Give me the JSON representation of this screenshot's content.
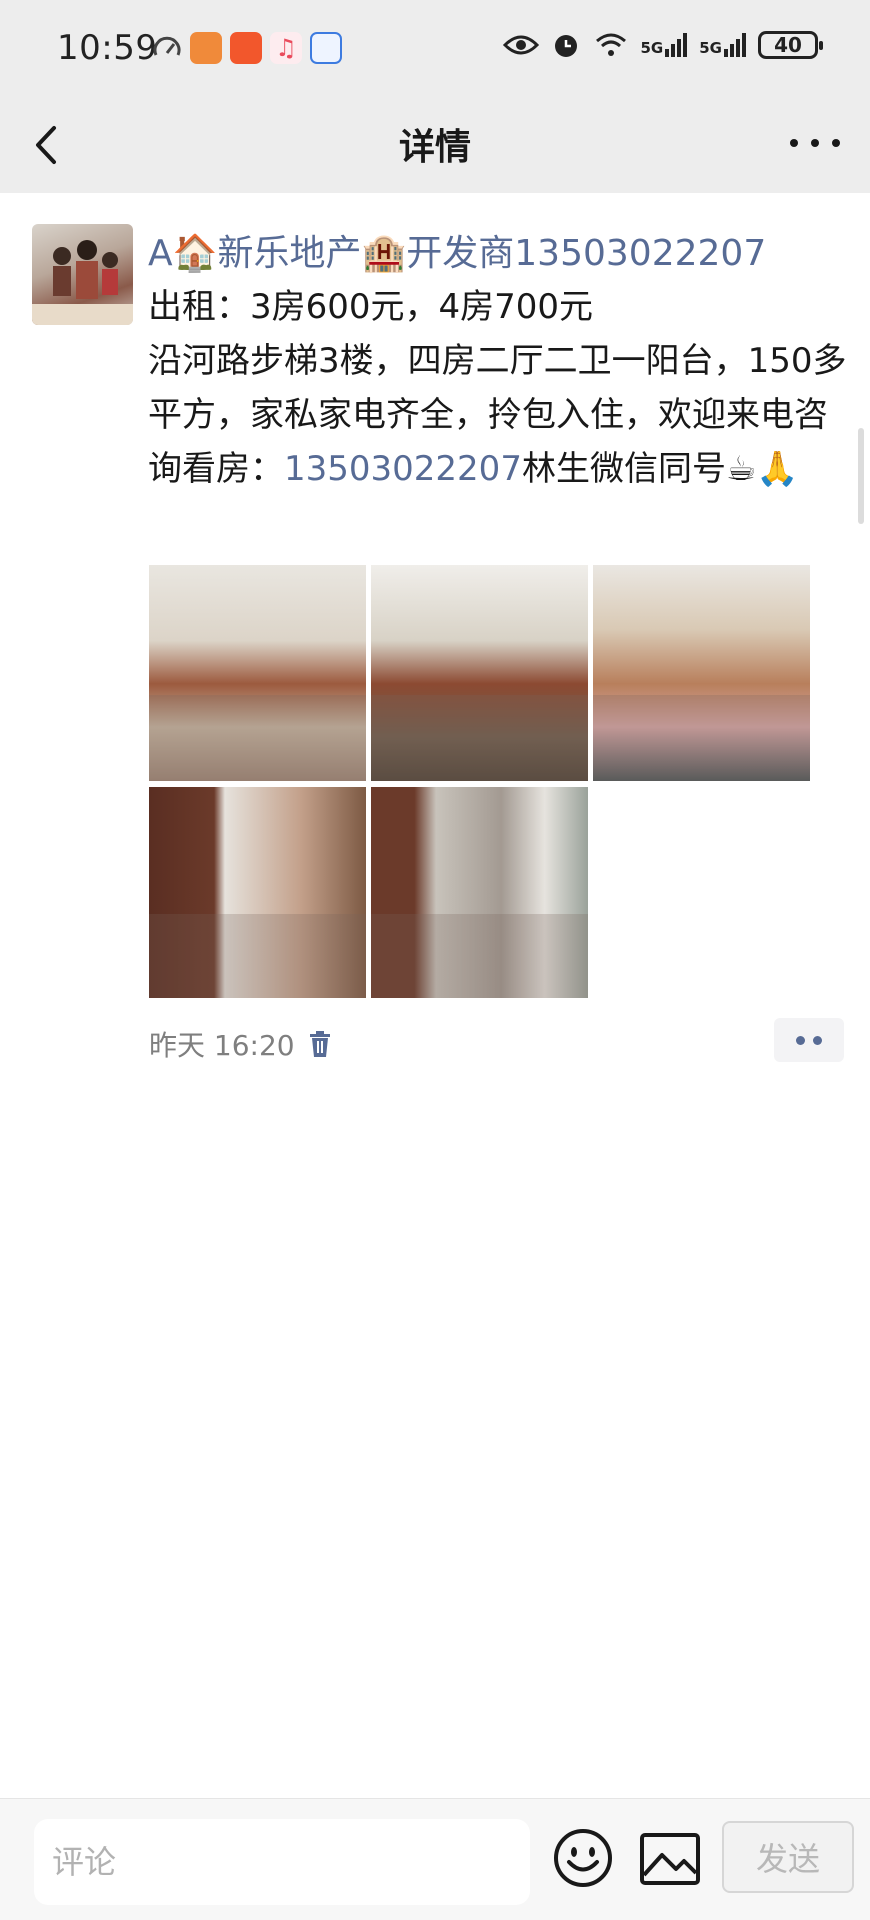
{
  "status_bar": {
    "time": "10:59",
    "battery": "40",
    "signal_1": "5G",
    "signal_2": "5G"
  },
  "nav": {
    "title": "详情"
  },
  "post": {
    "author": "A🏠新乐地产🏨开发商13503022207",
    "line1": "出租：3房600元，4房700元",
    "line2_pre": "沿河路步梯3楼，四房二厅二卫一阳台，150多平方，家私家电齐全，拎包入住，欢迎来电咨询看房：",
    "phone": "13503022207",
    "line2_post": "林生微信同号☕🙏",
    "time": "昨天 16:20"
  },
  "comment_bar": {
    "placeholder": "评论",
    "send_label": "发送"
  },
  "colors": {
    "link": "#576b95",
    "background": "#ededed"
  }
}
